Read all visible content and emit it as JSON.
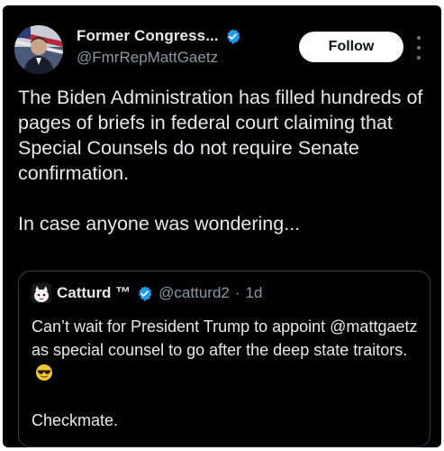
{
  "author": {
    "display_name": "Former Congress...",
    "handle": "@FmrRepMattGaetz"
  },
  "follow_label": "Follow",
  "tweet": {
    "paragraph_1": "The Biden Administration has filled hundreds of pages of briefs in federal court claiming that Special Counsels do not require Senate confirmation.",
    "paragraph_2": "In case anyone was wondering..."
  },
  "quoted": {
    "display_name": "Catturd ™",
    "handle": "@catturd2",
    "separator": "·",
    "age": "1d",
    "paragraph_1": "Can’t wait for President Trump to appoint @mattgaetz as special counsel to go after the deep state traitors.",
    "paragraph_2": "Checkmate."
  },
  "icons": {
    "verified": "verified-badge-icon",
    "more": "more-options-icon",
    "emoji": "sunglasses-face-emoji-icon"
  },
  "colors": {
    "background": "#000000",
    "text": "#e7e9ea",
    "secondary_text": "#8b98a5",
    "verified_blue": "#1d9bf0",
    "follow_button": "#ffffff"
  }
}
